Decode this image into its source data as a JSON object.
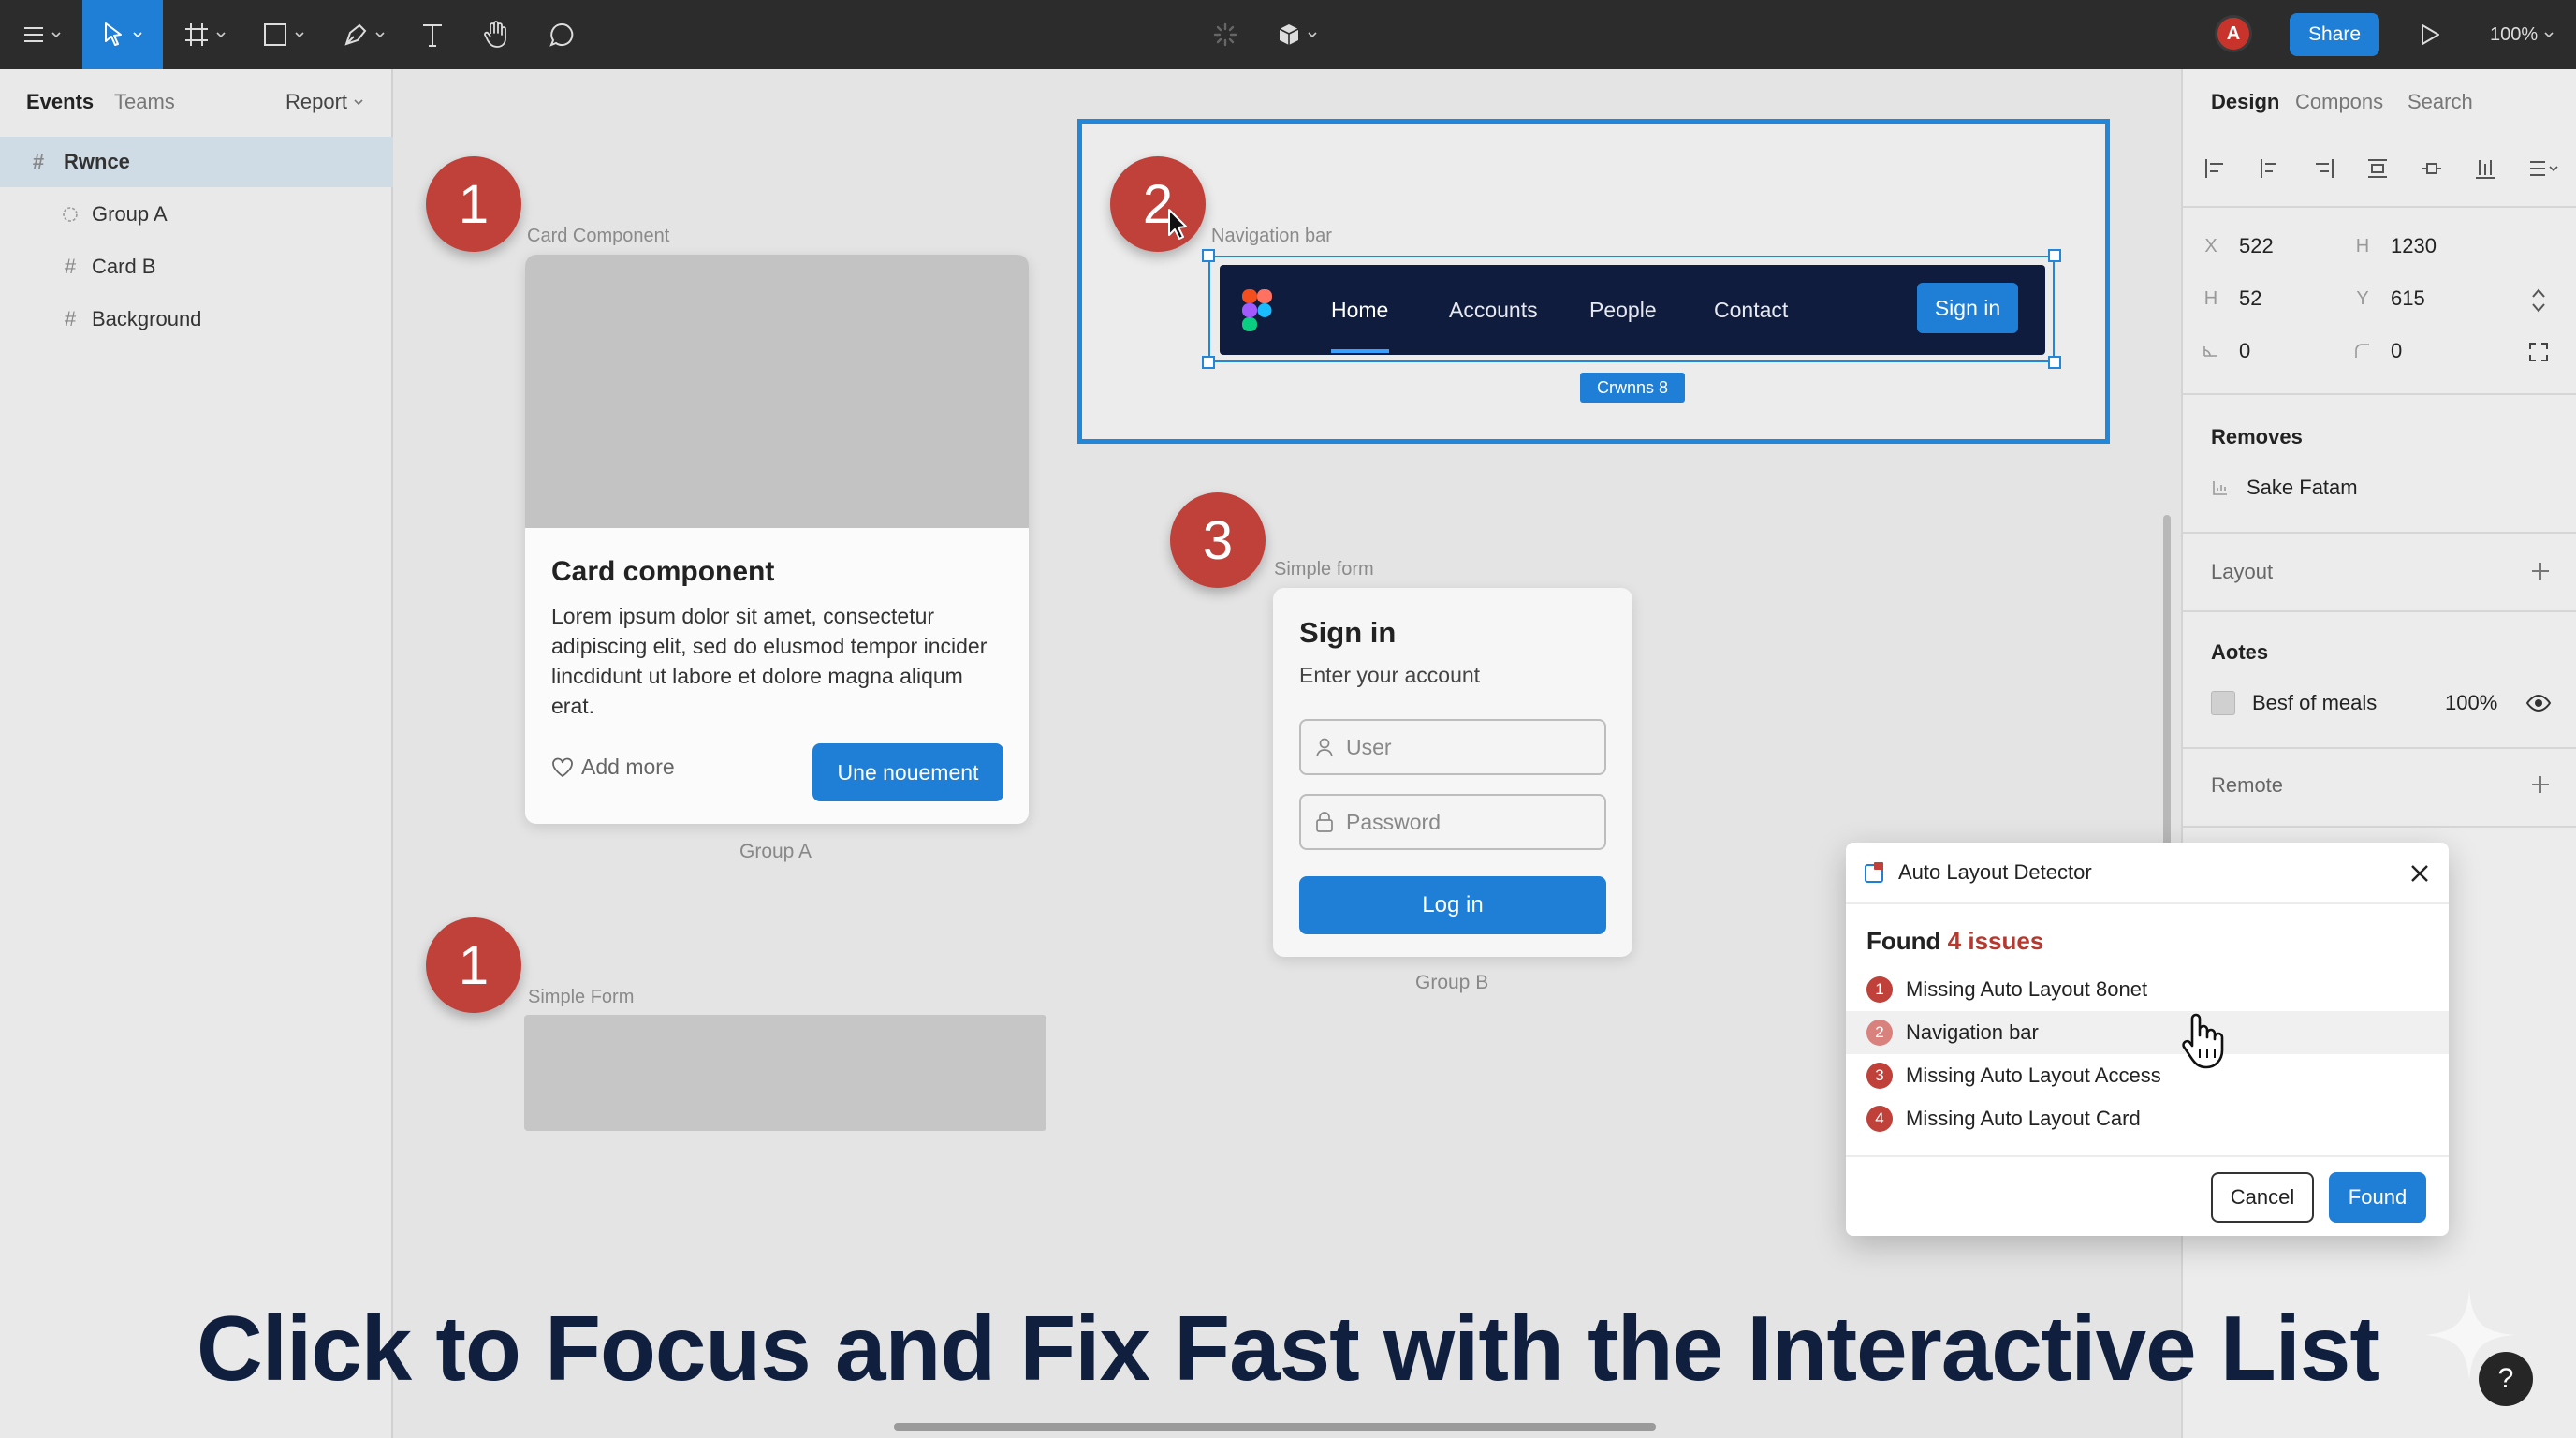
{
  "toolbar": {
    "share_label": "Share",
    "zoom": "100%",
    "avatar_initial": "A"
  },
  "left_panel": {
    "tabs": [
      "Events",
      "Teams"
    ],
    "report_label": "Report",
    "layers": [
      {
        "label": "Rwnce",
        "icon": "hash-icon"
      },
      {
        "label": "Group A",
        "icon": "component-icon"
      },
      {
        "label": "Card B",
        "icon": "hash-icon"
      },
      {
        "label": "Background",
        "icon": "hash-icon"
      }
    ]
  },
  "canvas": {
    "badges": [
      "1",
      "2",
      "3",
      "1"
    ],
    "card": {
      "frame_label": "Card Component",
      "title": "Card component",
      "body": "Lorem ipsum dolor sit amet, consectetur adipiscing elit, sed do elusmod tempor incider lincdidunt ut labore et dolore magna aliqum erat.",
      "add_label": "Add more",
      "button_label": "Une nouement",
      "group_label": "Group A"
    },
    "simple_form_label": "Simple Form",
    "navigation": {
      "frame_label": "Navigation bar",
      "items": [
        "Home",
        "Accounts",
        "People",
        "Contact"
      ],
      "signin_label": "Sign in",
      "dimension_tag": "Crwnns 8"
    },
    "signin_form": {
      "frame_label": "Simple form",
      "title": "Sign in",
      "subtitle": "Enter your account",
      "user_placeholder": "User",
      "password_placeholder": "Password",
      "login_label": "Log in",
      "group_label": "Group B"
    }
  },
  "dialog": {
    "title": "Auto Layout Detector",
    "found_prefix": "Found",
    "found_count": "4 issues",
    "issues": [
      {
        "num": "1",
        "label": "Missing Auto Layout 8onet"
      },
      {
        "num": "2",
        "label": "Navigation bar"
      },
      {
        "num": "3",
        "label": "Missing Auto Layout Access"
      },
      {
        "num": "4",
        "label": "Missing Auto Layout Card"
      }
    ],
    "cancel_label": "Cancel",
    "confirm_label": "Found"
  },
  "right_panel": {
    "tabs": [
      "Design",
      "Compons",
      "Search"
    ],
    "props": {
      "x_key": "X",
      "x": "522",
      "h_key": "H",
      "h": "1230",
      "h2_key": "H",
      "h2": "52",
      "y_key": "Y",
      "y": "615",
      "r1": "0",
      "r2": "0"
    },
    "removes": {
      "title": "Removes",
      "item": "Sake Fatam"
    },
    "layout_title": "Layout",
    "aotes": {
      "title": "Aotes",
      "fill_name": "Besf of meals",
      "fill_opacity": "100%"
    },
    "remote_title": "Remote"
  },
  "caption": "Click to Focus and Fix Fast with the Interactive List",
  "help_label": "?",
  "colors": {
    "accent": "#1f7fd6",
    "badge": "#c0403a",
    "navbar": "#101c3d",
    "toolbar": "#2c2c2c"
  }
}
